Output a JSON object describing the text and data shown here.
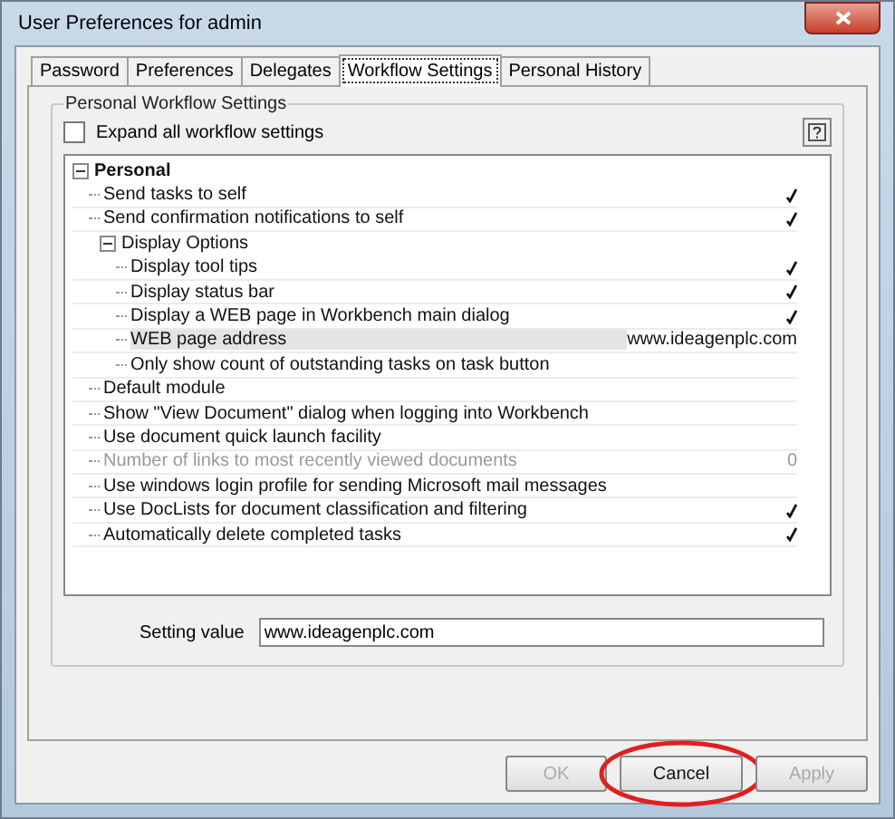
{
  "window": {
    "title": "User Preferences for admin"
  },
  "tabs": [
    {
      "label": "Password",
      "selected": false
    },
    {
      "label": "Preferences",
      "selected": false
    },
    {
      "label": "Delegates",
      "selected": false
    },
    {
      "label": "Workflow Settings",
      "selected": true
    },
    {
      "label": "Personal History",
      "selected": false
    }
  ],
  "group": {
    "title": "Personal Workflow Settings",
    "expand_all": {
      "label": "Expand all workflow settings",
      "checked": false
    }
  },
  "tree": [
    {
      "kind": "group",
      "label": "Personal",
      "expanded": true,
      "children": [
        {
          "kind": "setting",
          "label": "Send tasks to self",
          "checked": true,
          "disabled": false,
          "selected": false
        },
        {
          "kind": "setting",
          "label": "Send confirmation notifications to self",
          "checked": true,
          "disabled": false,
          "selected": false
        },
        {
          "kind": "group",
          "label": "Display Options",
          "expanded": true,
          "children": [
            {
              "kind": "setting",
              "label": "Display tool tips",
              "checked": true,
              "disabled": false,
              "selected": false
            },
            {
              "kind": "setting",
              "label": "Display status bar",
              "checked": true,
              "disabled": false,
              "selected": false
            },
            {
              "kind": "setting",
              "label": "Display a WEB page in Workbench main dialog",
              "checked": true,
              "disabled": false,
              "selected": false
            },
            {
              "kind": "setting",
              "label": "WEB page address",
              "value": "www.ideagenplc.com",
              "checked": false,
              "disabled": false,
              "selected": true
            },
            {
              "kind": "setting",
              "label": "Only show count of outstanding tasks on task button",
              "checked": false,
              "disabled": false,
              "selected": false
            }
          ]
        },
        {
          "kind": "setting",
          "label": "Default module",
          "checked": false,
          "disabled": false,
          "selected": false
        },
        {
          "kind": "setting",
          "label": "Show \"View Document\" dialog when logging into Workbench",
          "checked": false,
          "disabled": false,
          "selected": false
        },
        {
          "kind": "setting",
          "label": "Use document quick launch facility",
          "checked": false,
          "disabled": false,
          "selected": false
        },
        {
          "kind": "setting",
          "label": "Number of links to most recently viewed documents",
          "value": "0",
          "checked": false,
          "disabled": true,
          "selected": false
        },
        {
          "kind": "setting",
          "label": "Use windows login profile for sending Microsoft mail messages",
          "checked": false,
          "disabled": false,
          "selected": false
        },
        {
          "kind": "setting",
          "label": "Use DocLists for document classification and filtering",
          "checked": true,
          "disabled": false,
          "selected": false
        },
        {
          "kind": "setting",
          "label": "Automatically delete completed tasks",
          "checked": true,
          "disabled": false,
          "selected": false
        }
      ]
    }
  ],
  "setting_value": {
    "label": "Setting value",
    "value": "www.ideagenplc.com"
  },
  "buttons": [
    {
      "label": "OK",
      "disabled": true,
      "circled": false
    },
    {
      "label": "Cancel",
      "disabled": false,
      "circled": true
    },
    {
      "label": "Apply",
      "disabled": true,
      "circled": false
    }
  ]
}
